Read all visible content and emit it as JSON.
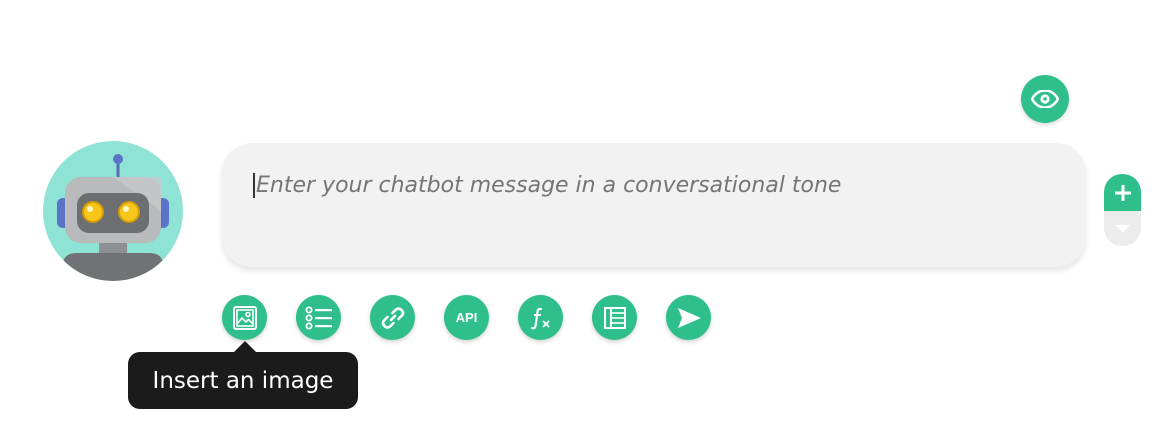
{
  "header": {
    "preview_icon": "eye-icon"
  },
  "bot": {
    "avatar_icon": "robot-avatar"
  },
  "composer": {
    "placeholder": "Enter your chatbot message in a conversational tone",
    "value": ""
  },
  "side_controls": {
    "add_icon": "plus-icon",
    "more_icon": "chevron-down-icon"
  },
  "toolbar": {
    "tools": [
      {
        "icon": "image-icon"
      },
      {
        "icon": "list-icon"
      },
      {
        "icon": "link-icon"
      },
      {
        "icon": "api-icon",
        "label": "API"
      },
      {
        "icon": "function-icon"
      },
      {
        "icon": "table-icon"
      },
      {
        "icon": "send-icon"
      }
    ]
  },
  "tooltip": {
    "text": "Insert an image"
  },
  "colors": {
    "accent": "#2fbf8b",
    "avatar_bg": "#8ee3d5",
    "input_bg": "#f2f2f2",
    "tooltip_bg": "#1b1b1b"
  }
}
